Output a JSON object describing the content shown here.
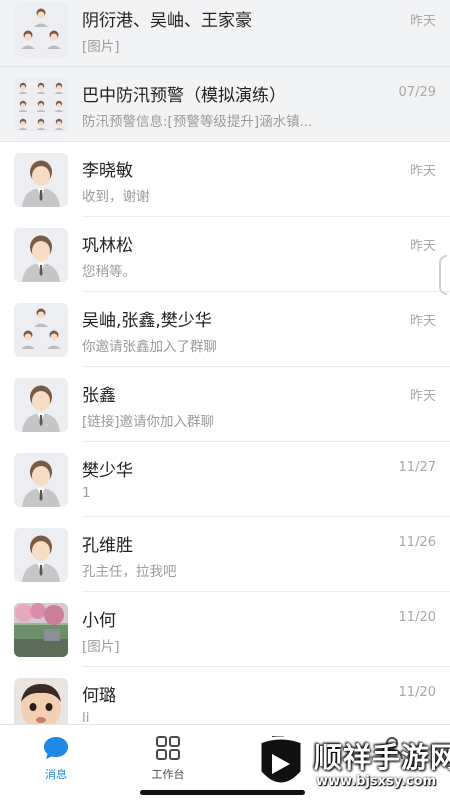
{
  "chats": [
    {
      "name": "阴衍港、吴岫、王家豪",
      "preview": "[图片]",
      "time": "昨天",
      "avatar": "group-avatar"
    },
    {
      "name": "巴中防汛预警（模拟演练）",
      "preview": "防汛预警信息:[预警等级提升]涵水镇...",
      "time": "07/29",
      "avatar": "group-avatar"
    },
    {
      "name": "李晓敏",
      "preview": "收到，谢谢",
      "time": "昨天",
      "avatar": "user-avatar"
    },
    {
      "name": "巩林松",
      "preview": "您稍等。",
      "time": "昨天",
      "avatar": "user-avatar"
    },
    {
      "name": "吴岫,张鑫,樊少华",
      "preview": "你邀请张鑫加入了群聊",
      "time": "昨天",
      "avatar": "group-avatar"
    },
    {
      "name": "张鑫",
      "preview": "[链接]邀请你加入群聊",
      "time": "昨天",
      "avatar": "user-avatar"
    },
    {
      "name": "樊少华",
      "preview": "1",
      "time": "11/27",
      "avatar": "user-avatar"
    },
    {
      "name": "孔维胜",
      "preview": "孔主任，拉我吧",
      "time": "11/26",
      "avatar": "user-avatar"
    },
    {
      "name": "小何",
      "preview": "[图片]",
      "time": "11/20",
      "avatar": "photo-avatar"
    },
    {
      "name": "何璐",
      "preview": "li",
      "time": "11/20",
      "avatar": "baby-photo-avatar"
    }
  ],
  "tabs": [
    {
      "label": "消息",
      "icon": "chat-bubble-icon",
      "active": true
    },
    {
      "label": "工作台",
      "icon": "grid-icon",
      "active": false
    },
    {
      "label": "",
      "icon": "docs-icon",
      "active": false
    },
    {
      "label": "",
      "icon": "contacts-icon",
      "active": false
    }
  ],
  "watermark": {
    "title": "顺祥手游网",
    "url": "www.bjsxsy.com"
  },
  "colors": {
    "accent": "#1e88e5",
    "pinned_bg": "#f2f3f5",
    "preview": "#9b9b9b",
    "time": "#a8a8a8"
  }
}
